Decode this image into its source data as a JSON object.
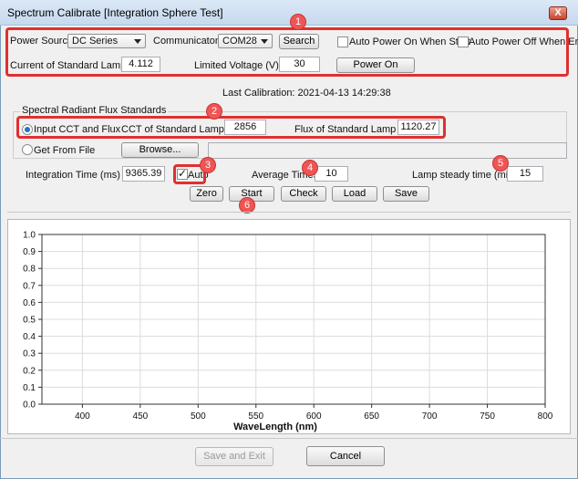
{
  "window": {
    "title": "Spectrum Calibrate [Integration Sphere Test]",
    "close_label": "X"
  },
  "power": {
    "source_label": "Power Source",
    "source_value": "DC Series",
    "comm_label": "Communicaton",
    "comm_value": "COM28",
    "search_label": "Search",
    "auto_on_label": "Auto Power On When Start",
    "auto_on_checked": false,
    "auto_off_label": "Auto Power Off When End",
    "auto_off_checked": false,
    "current_label": "Current of Standard Lamp (A)",
    "current_value": "4.112",
    "voltage_label": "Limited Voltage (V)",
    "voltage_value": "30",
    "power_on_label": "Power On"
  },
  "last_calibration": "Last Calibration: 2021-04-13 14:29:38",
  "standards": {
    "group_label": "Spectral Radiant Flux Standards",
    "input_label": "Input CCT and Flux",
    "input_selected": true,
    "cct_label": "CCT of Standard Lamp (K)",
    "cct_value": "2856",
    "flux_label": "Flux of Standard Lamp (lm)",
    "flux_value": "1120.27",
    "file_label": "Get From File",
    "file_selected": false,
    "browse_label": "Browse...",
    "file_path": ""
  },
  "measurement": {
    "integration_label": "Integration Time (ms)",
    "integration_value": "9365.39",
    "auto_label": "Auto",
    "auto_checked": true,
    "average_label": "Average Times",
    "average_value": "10",
    "steady_label": "Lamp steady time (min):",
    "steady_value": "15"
  },
  "actions": {
    "zero": "Zero",
    "start": "Start",
    "check": "Check",
    "load": "Load",
    "save": "Save"
  },
  "badges": [
    "1",
    "2",
    "3",
    "4",
    "5",
    "6"
  ],
  "footer": {
    "save_exit": "Save and Exit",
    "cancel": "Cancel"
  },
  "chart_data": {
    "type": "line",
    "xlabel": "WaveLength (nm)",
    "ylabel": "",
    "xlim": [
      365,
      800
    ],
    "ylim": [
      0,
      1.0
    ],
    "x_ticks": [
      "400",
      "450",
      "500",
      "550",
      "600",
      "650",
      "700",
      "750",
      "800"
    ],
    "y_ticks": [
      "0.0",
      "0.1",
      "0.2",
      "0.3",
      "0.4",
      "0.5",
      "0.6",
      "0.7",
      "0.8",
      "0.9",
      "1.0"
    ],
    "series": [],
    "grid": true
  }
}
